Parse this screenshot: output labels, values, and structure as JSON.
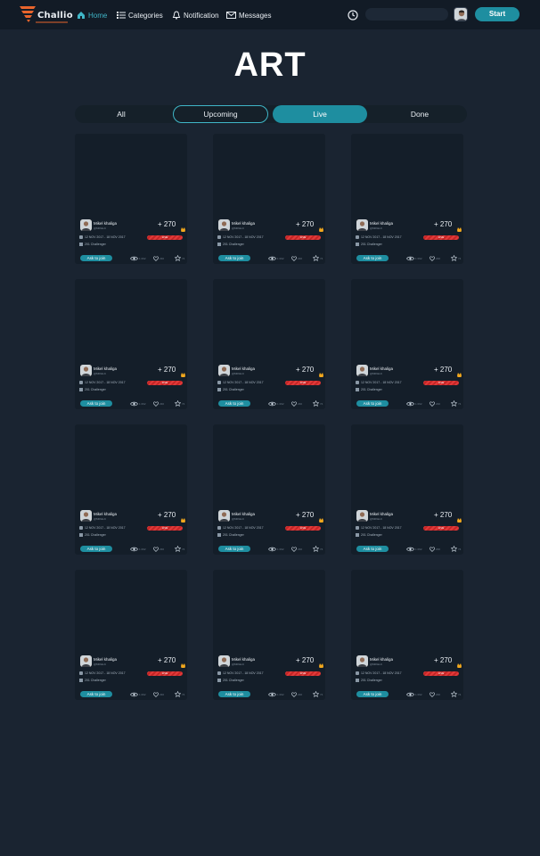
{
  "nav": {
    "logo_text": "Challio",
    "items": [
      {
        "label": "Home",
        "icon": "home-icon",
        "active": true
      },
      {
        "label": "Categories",
        "icon": "list-icon",
        "active": false
      },
      {
        "label": "Notification",
        "icon": "bell-icon",
        "active": false
      },
      {
        "label": "Messages",
        "icon": "envelope-icon",
        "active": false
      }
    ],
    "search_placeholder": "",
    "start_label": "Start"
  },
  "page": {
    "title": "ART"
  },
  "tabs": [
    {
      "label": "All",
      "state": "plain"
    },
    {
      "label": "Upcoming",
      "state": "outline"
    },
    {
      "label": "Live",
      "state": "selected"
    },
    {
      "label": "Done",
      "state": "plain"
    }
  ],
  "card_common": {
    "user_name": "Mikel khaliga",
    "user_sub": "@MIKELK",
    "points": "+ 270",
    "date_range": "12 NOV 2017 - 18 NOV 2017",
    "challengers": "201 Challenger",
    "bar_label": "LIVE",
    "join_label": "Ask to join",
    "views": "1 092",
    "likes": "230",
    "stars": "74"
  },
  "cards": [
    {
      "art": "popart"
    },
    {
      "art": "icons"
    },
    {
      "art": "popart"
    },
    {
      "art": "popart"
    },
    {
      "art": "icons"
    },
    {
      "art": "popart"
    },
    {
      "art": "icons"
    },
    {
      "art": "icons"
    },
    {
      "art": "popart"
    },
    {
      "art": "popart"
    },
    {
      "art": "icons"
    },
    {
      "art": "popart"
    }
  ],
  "colors": {
    "accent": "#1e8ea0",
    "accent_light": "#3fb6c7",
    "background": "#1a2431",
    "live_bar": "#e03a3a"
  }
}
